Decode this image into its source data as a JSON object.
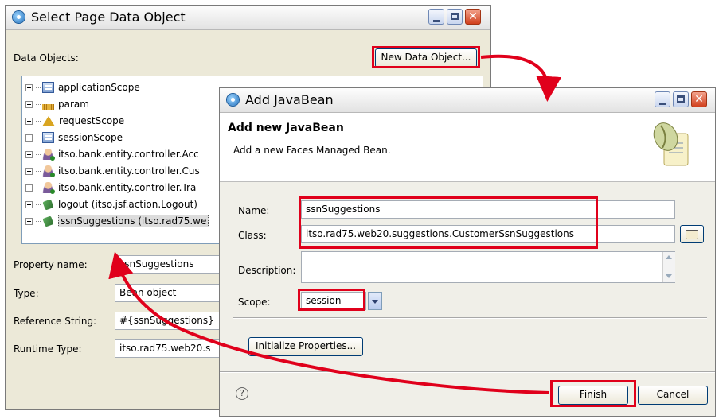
{
  "select_dialog": {
    "title": "Select Page Data Object",
    "data_objects_label": "Data Objects:",
    "new_button": "New Data Object...",
    "tree": [
      {
        "icon": "scope-icon",
        "label": "applicationScope"
      },
      {
        "icon": "param-icon",
        "label": "param"
      },
      {
        "icon": "request-scope-icon",
        "label": "requestScope"
      },
      {
        "icon": "scope-icon",
        "label": "sessionScope"
      },
      {
        "icon": "bean-icon",
        "label": "itso.bank.entity.controller.Acc"
      },
      {
        "icon": "bean-icon",
        "label": "itso.bank.entity.controller.Cus"
      },
      {
        "icon": "bean-icon",
        "label": "itso.bank.entity.controller.Tra"
      },
      {
        "icon": "jsf-bean-icon",
        "label": "logout (itso.jsf.action.Logout)"
      },
      {
        "icon": "jsf-bean-icon",
        "label": "ssnSuggestions (itso.rad75.we"
      }
    ],
    "props": {
      "property_name_label": "Property name:",
      "property_name_value": "ssnSuggestions",
      "type_label": "Type:",
      "type_value": "Bean object",
      "reference_label": "Reference String:",
      "reference_value": "#{ssnSuggestions}",
      "runtime_label": "Runtime Type:",
      "runtime_value": "itso.rad75.web20.s"
    }
  },
  "javabean_dialog": {
    "title": "Add JavaBean",
    "header_title": "Add new JavaBean",
    "header_desc": "Add a new Faces Managed Bean.",
    "name_label": "Name:",
    "name_value": "ssnSuggestions",
    "class_label": "Class:",
    "class_value": "itso.rad75.web20.suggestions.CustomerSsnSuggestions",
    "description_label": "Description:",
    "description_value": "",
    "scope_label": "Scope:",
    "scope_value": "session",
    "init_button": "Initialize Properties...",
    "finish_button": "Finish",
    "cancel_button": "Cancel"
  },
  "colors": {
    "highlight": "#e0001b",
    "dialog_bg": "#ece9d8"
  }
}
